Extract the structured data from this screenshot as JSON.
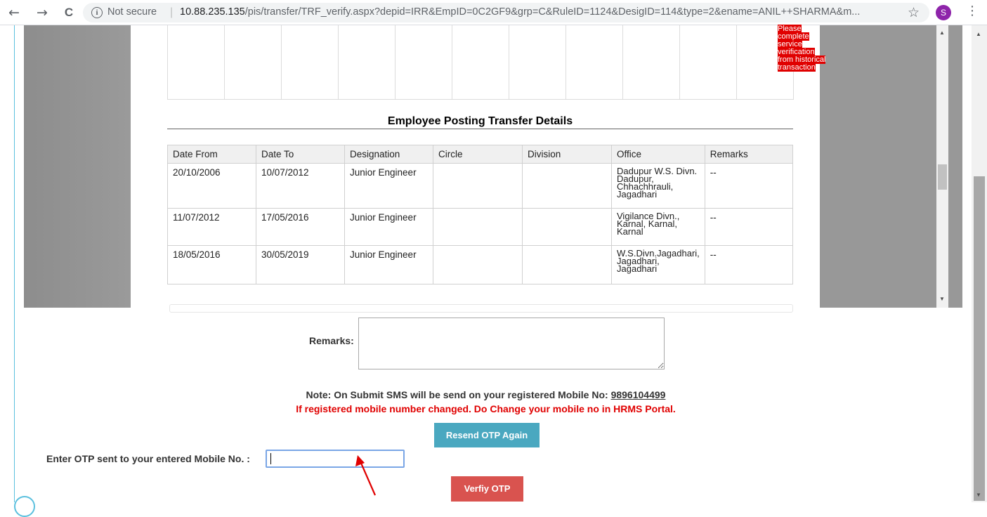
{
  "browser": {
    "back_icon": "←",
    "forward_icon": "→",
    "reload_icon": "C",
    "security_label": "Not secure",
    "url_host": "10.88.235.135",
    "url_path": "/pis/transfer/TRF_verify.aspx?depid=IRR&EmpID=0C2GF9&grp=C&RuleID=1124&DesigID=114&type=2&ename=ANIL++SHARMA&m...",
    "star_icon": "☆",
    "profile_initial": "S",
    "menu_icon": "⋮"
  },
  "top_table": {
    "warning_text": "Please complete service verification from historical transaction"
  },
  "posting": {
    "title": "Employee Posting Transfer Details",
    "columns": [
      "Date From",
      "Date To",
      "Designation",
      "Circle",
      "Division",
      "Office",
      "Remarks"
    ],
    "rows": [
      {
        "from": "20/10/2006",
        "to": "10/07/2012",
        "designation": "Junior Engineer",
        "circle": "",
        "division": "",
        "office": "Dadupur W.S. Divn. Dadupur, Chhachhrauli, Jagadhari",
        "remarks": "--"
      },
      {
        "from": "11/07/2012",
        "to": "17/05/2016",
        "designation": "Junior Engineer",
        "circle": "",
        "division": "",
        "office": "Vigilance Divn., Karnal, Karnal, Karnal",
        "remarks": "--"
      },
      {
        "from": "18/05/2016",
        "to": "30/05/2019",
        "designation": "Junior Engineer",
        "circle": "",
        "division": "",
        "office": "W.S.Divn.Jagadhari, Jagadhari, Jagadhari",
        "remarks": "--"
      }
    ]
  },
  "form": {
    "remarks_label": "Remarks:",
    "remarks_value": "",
    "note_text": "Note: On Submit SMS will be send on your registered Mobile No:",
    "mobile_number": "9896104499",
    "warning_text": "If registered mobile number changed. Do Change your mobile no in HRMS Portal.",
    "resend_label": "Resend OTP Again",
    "otp_label": "Enter OTP sent to your entered Mobile No. :",
    "otp_value": "",
    "verify_label": "Verfiy OTP"
  },
  "colors": {
    "resend_bg": "#4aa8c0",
    "verify_bg": "#d9534f",
    "warning_red": "#e00000",
    "annotation_arrow": "#e00000"
  }
}
